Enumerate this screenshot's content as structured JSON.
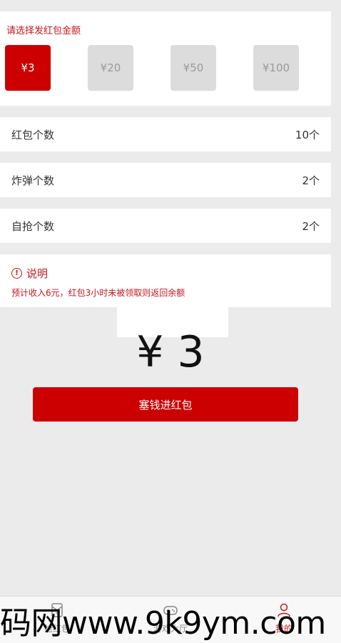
{
  "amount_section": {
    "title": "请选择发红包金额",
    "options": [
      "¥3",
      "¥20",
      "¥50",
      "¥100"
    ],
    "selected_index": 0
  },
  "settings": {
    "red_packet_count": {
      "label": "红包个数",
      "value": "10个"
    },
    "bomb_count": {
      "label": "炸弹个数",
      "value": "2个"
    },
    "self_grab_count": {
      "label": "自抢个数",
      "value": "2个"
    }
  },
  "note": {
    "title": "说明",
    "text": "预计收入6元，红包3小时未被领取则返回余额"
  },
  "total_amount": "¥ 3",
  "submit_label": "塞钱进红包",
  "bottom_nav": {
    "items": [
      {
        "label": "抢红包",
        "icon": "red-packet-icon",
        "active": false
      },
      {
        "label": "游戏大厅",
        "icon": "gamepad-icon",
        "active": false
      },
      {
        "label": "我的",
        "icon": "user-icon",
        "active": true
      }
    ]
  },
  "watermark": "码网www.9k9ym.com",
  "colors": {
    "accent": "#cc0000",
    "text_red": "#c8161d",
    "background": "#ebebeb"
  }
}
